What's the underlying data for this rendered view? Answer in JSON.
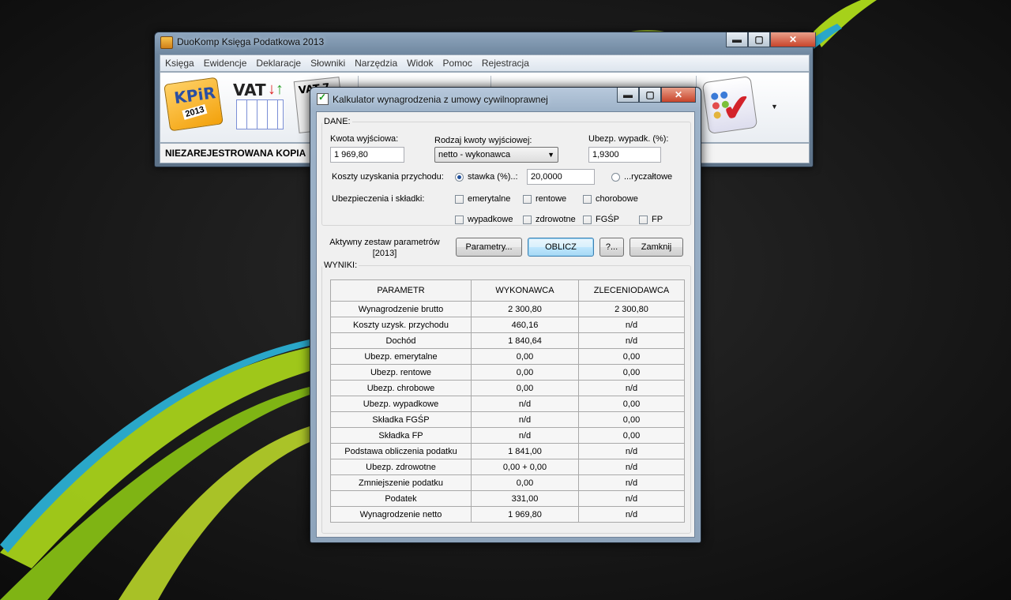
{
  "main_window": {
    "title": "DuoKomp Księga Podatkowa 2013",
    "caption_buttons": {
      "minimize": "▬",
      "maximize": "▢",
      "close": "✕"
    },
    "menu": [
      "Księga",
      "Ewidencje",
      "Deklaracje",
      "Słowniki",
      "Narzędzia",
      "Widok",
      "Pomoc",
      "Rejestracja"
    ],
    "toolbar": {
      "kpir_label": "KPiR",
      "kpir_year": "2013",
      "vat_label": "VAT",
      "vat7_label": "VAT-7",
      "more_arrow": "▼"
    },
    "status_text": "NIEZAREJESTROWANA KOPIA W TRYBIE"
  },
  "dialog": {
    "title": "Kalkulator wynagrodzenia z umowy cywilnoprawnej",
    "caption_buttons": {
      "minimize": "▬",
      "maximize": "▢",
      "close": "✕"
    },
    "dane": {
      "legend": "DANE:",
      "kwota_label": "Kwota wyjściowa:",
      "kwota_value": "1 969,80",
      "rodzaj_label": "Rodzaj kwoty wyjściowej:",
      "rodzaj_value": "netto - wykonawca",
      "rodzaj_arrow": "▼",
      "ubezp_wypadk_label": "Ubezp. wypadk. (%):",
      "ubezp_wypadk_value": "1,9300",
      "koszty_label": "Koszty uzyskania przychodu:",
      "stawka_label": "stawka (%)..:",
      "stawka_value": "20,0000",
      "stawka_selected": true,
      "ryczaltowe_label": "...ryczałtowe",
      "ubezpieczenia_label": "Ubezpieczenia i składki:",
      "checkboxes": {
        "emerytalne": {
          "label": "emerytalne",
          "checked": false
        },
        "rentowe": {
          "label": "rentowe",
          "checked": false
        },
        "chorobowe": {
          "label": "chorobowe",
          "checked": false
        },
        "wypadkowe": {
          "label": "wypadkowe",
          "checked": false
        },
        "zdrowotne": {
          "label": "zdrowotne",
          "checked": false
        },
        "fgsp": {
          "label": "FGŚP",
          "checked": false
        },
        "fp": {
          "label": "FP",
          "checked": false
        }
      }
    },
    "aktywny_line1": "Aktywny zestaw parametrów",
    "aktywny_line2": "[2013]",
    "buttons": {
      "parametry": "Parametry...",
      "oblicz": "OBLICZ",
      "help": "?...",
      "zamknij": "Zamknij"
    },
    "wyniki": {
      "legend": "WYNIKI:",
      "columns": [
        "PARAMETR",
        "WYKONAWCA",
        "ZLECENIODAWCA"
      ],
      "rows": [
        [
          "Wynagrodzenie brutto",
          "2 300,80",
          "2 300,80"
        ],
        [
          "Koszty uzysk. przychodu",
          "460,16",
          "n/d"
        ],
        [
          "Dochód",
          "1 840,64",
          "n/d"
        ],
        [
          "Ubezp. emerytalne",
          "0,00",
          "0,00"
        ],
        [
          "Ubezp. rentowe",
          "0,00",
          "0,00"
        ],
        [
          "Ubezp. chrobowe",
          "0,00",
          "n/d"
        ],
        [
          "Ubezp. wypadkowe",
          "n/d",
          "0,00"
        ],
        [
          "Składka FGŚP",
          "n/d",
          "0,00"
        ],
        [
          "Składka FP",
          "n/d",
          "0,00"
        ],
        [
          "Podstawa obliczenia podatku",
          "1 841,00",
          "n/d"
        ],
        [
          "Ubezp. zdrowotne",
          "0,00 + 0,00",
          "n/d"
        ],
        [
          "Zmniejszenie podatku",
          "0,00",
          "n/d"
        ],
        [
          "Podatek",
          "331,00",
          "n/d"
        ],
        [
          "Wynagrodzenie netto",
          "1 969,80",
          "n/d"
        ]
      ]
    }
  },
  "colors": {
    "desktop_bg": "#141414",
    "swirl_green": "#a6d11a",
    "swirl_blue": "#2aa7c9",
    "window_frame": "#8ea4bb"
  }
}
